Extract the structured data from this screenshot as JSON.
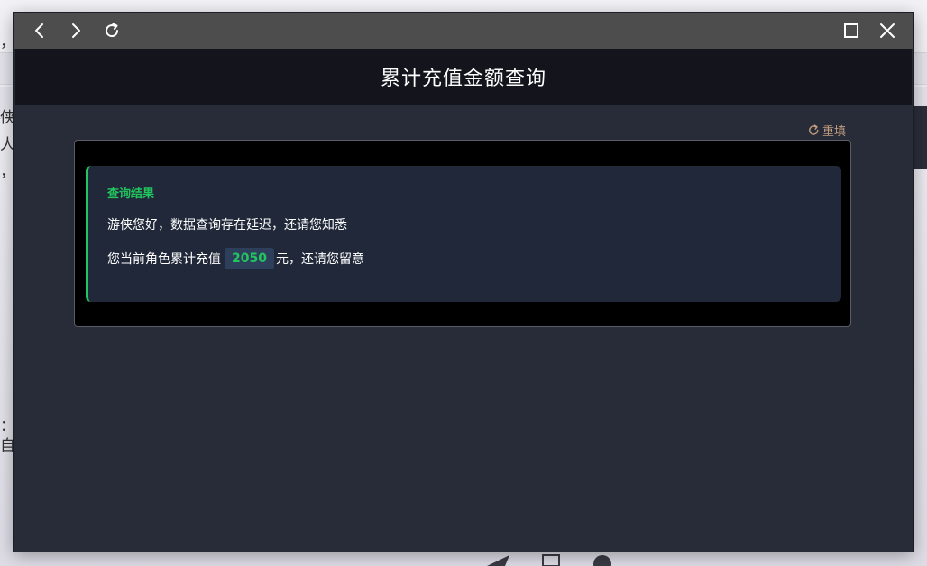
{
  "window": {
    "title": "累计充值金额查询",
    "nav": {
      "back_icon": "chevron-left-icon",
      "forward_icon": "chevron-right-icon",
      "refresh_icon": "refresh-icon",
      "maximize_icon": "maximize-icon",
      "close_icon": "close-icon"
    }
  },
  "toolbar": {
    "reset_label": "重填",
    "reset_icon": "refresh-icon"
  },
  "result": {
    "title": "查询结果",
    "greeting": "游侠您好，数据查询存在延迟，还请您知悉",
    "prefix": "您当前角色累计充值",
    "amount": "2050",
    "suffix": "元，还请您留意"
  },
  "colors": {
    "accent": "#22c55e",
    "reset": "#c19d7e",
    "titlebar": "#4d4d4d",
    "header": "#13141c",
    "background": "#282b38",
    "result_box": "#202839"
  },
  "background_page": {
    "left_glyphs": [
      "，",
      "侠",
      "人",
      "，",
      "：",
      "自"
    ]
  }
}
